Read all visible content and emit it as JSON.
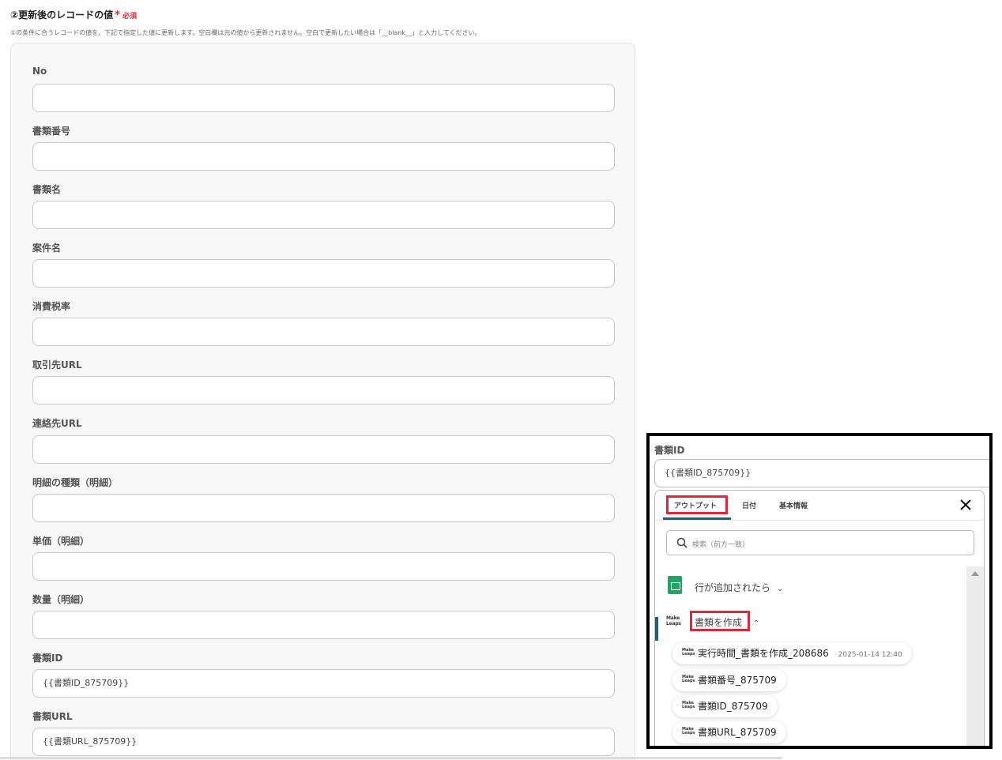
{
  "section": {
    "title": "②更新後のレコードの値",
    "required_label": "必須",
    "description": "①の条件に合うレコードの値を、下記で指定した値に更新します。空白欄は元の値から更新されません。空白で更新したい場合は「__blank__」と入力してください。"
  },
  "fields": [
    {
      "label": "No",
      "value": ""
    },
    {
      "label": "書類番号",
      "value": ""
    },
    {
      "label": "書類名",
      "value": ""
    },
    {
      "label": "案件名",
      "value": ""
    },
    {
      "label": "消費税率",
      "value": ""
    },
    {
      "label": "取引先URL",
      "value": ""
    },
    {
      "label": "連絡先URL",
      "value": ""
    },
    {
      "label": "明細の種類（明細）",
      "value": ""
    },
    {
      "label": "単価（明細）",
      "value": ""
    },
    {
      "label": "数量（明細）",
      "value": ""
    },
    {
      "label": "書類ID",
      "value": "{{書類ID_875709}}"
    },
    {
      "label": "書類URL",
      "value": "{{書類URL_875709}}"
    }
  ],
  "inset": {
    "field_label": "書類ID",
    "field_value": "{{書類ID_875709}}",
    "tabs": [
      "アウトプット",
      "日付",
      "基本情報"
    ],
    "search_placeholder": "検索（前方一致）",
    "group1": "行が追加されたら",
    "group2": "書類を作成",
    "logo_text": [
      "Make",
      "Leaps"
    ],
    "items": [
      {
        "label": "実行時間_書類を作成_208686",
        "timestamp": "2025-01-14 12:40"
      },
      {
        "label": "書類番号_875709"
      },
      {
        "label": "書類ID_875709"
      },
      {
        "label": "書類URL_875709"
      }
    ],
    "accent_color": "#e0283a",
    "tab_underline_color": "#1e5f74",
    "sheet_icon_color": "#1fa463"
  }
}
